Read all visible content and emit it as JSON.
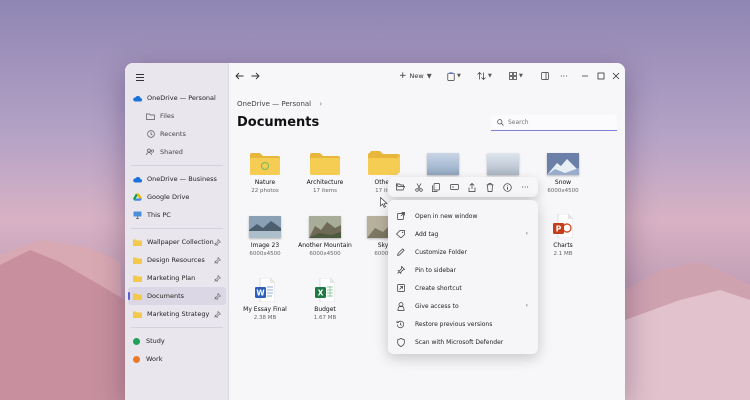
{
  "sidebar": {
    "items": [
      {
        "label": "OneDrive — Personal",
        "type": "top",
        "icon": "cloud-icon"
      },
      {
        "label": "Files",
        "type": "sub",
        "icon": "folder-outline-icon"
      },
      {
        "label": "Recents",
        "type": "sub",
        "icon": "clock-icon"
      },
      {
        "label": "Shared",
        "type": "sub",
        "icon": "people-icon"
      },
      {
        "label": "OneDrive — Business",
        "type": "top",
        "icon": "cloud-icon"
      },
      {
        "label": "Google Drive",
        "type": "top",
        "icon": "google-drive-icon"
      },
      {
        "label": "This PC",
        "type": "top",
        "icon": "monitor-icon"
      },
      {
        "label": "Wallpaper Collection",
        "type": "pinned",
        "icon": "folder-icon"
      },
      {
        "label": "Design Resources",
        "type": "pinned",
        "icon": "folder-icon"
      },
      {
        "label": "Marketing Plan",
        "type": "pinned",
        "icon": "folder-icon"
      },
      {
        "label": "Documents",
        "type": "pinned-active",
        "icon": "folder-icon"
      },
      {
        "label": "Marketing Strategy",
        "type": "pinned",
        "icon": "folder-icon"
      },
      {
        "label": "Study",
        "type": "tag",
        "color": "#22a05a"
      },
      {
        "label": "Work",
        "type": "tag",
        "color": "#e87a2a"
      }
    ]
  },
  "toolbar": {
    "new_label": "New"
  },
  "breadcrumb": {
    "location": "OneDrive — Personal"
  },
  "page": {
    "title": "Documents"
  },
  "search": {
    "placeholder": "Search"
  },
  "files": [
    {
      "name": "Nature",
      "meta": "22 photos",
      "kind": "folder"
    },
    {
      "name": "Architecture",
      "meta": "17 items",
      "kind": "folder"
    },
    {
      "name": "Other",
      "meta": "17 ite",
      "kind": "folder"
    },
    {
      "name": "",
      "meta": "",
      "kind": "photo-sky"
    },
    {
      "name": "",
      "meta": "",
      "kind": "photo-mist"
    },
    {
      "name": "Snow",
      "meta": "6000x4500",
      "kind": "photo-snow"
    },
    {
      "name": "Image 23",
      "meta": "6000x4500",
      "kind": "photo-lake"
    },
    {
      "name": "Another Mountain",
      "meta": "6000x4500",
      "kind": "photo-mountain"
    },
    {
      "name": "Sky",
      "meta": "6000x",
      "kind": "photo-sky2"
    },
    {
      "name": "Charts",
      "meta": "2.1 MB",
      "kind": "ppt"
    },
    {
      "name": "My Essay Final",
      "meta": "2.38 MB",
      "kind": "word"
    },
    {
      "name": "Budget",
      "meta": "1.67 MB",
      "kind": "excel"
    }
  ],
  "context_menu": {
    "items": [
      {
        "label": "Open in new window",
        "icon": "open-window-icon",
        "submenu": false
      },
      {
        "label": "Add tag",
        "icon": "tag-icon",
        "submenu": true
      },
      {
        "label": "Customize Folder",
        "icon": "pencil-icon",
        "submenu": false
      },
      {
        "label": "Pin to sidebar",
        "icon": "pin-icon",
        "submenu": false
      },
      {
        "label": "Create shortcut",
        "icon": "shortcut-icon",
        "submenu": false
      },
      {
        "label": "Give access to",
        "icon": "access-icon",
        "submenu": true
      },
      {
        "label": "Restore previous versions",
        "icon": "history-icon",
        "submenu": false
      },
      {
        "label": "Scan with Microsoft Defender",
        "icon": "shield-icon",
        "submenu": false
      }
    ]
  },
  "colors": {
    "accent": "#5b5fc7",
    "folder": "#f2c94c",
    "onedrive": "#1a73d9",
    "study": "#22a05a",
    "work": "#e87a2a"
  }
}
